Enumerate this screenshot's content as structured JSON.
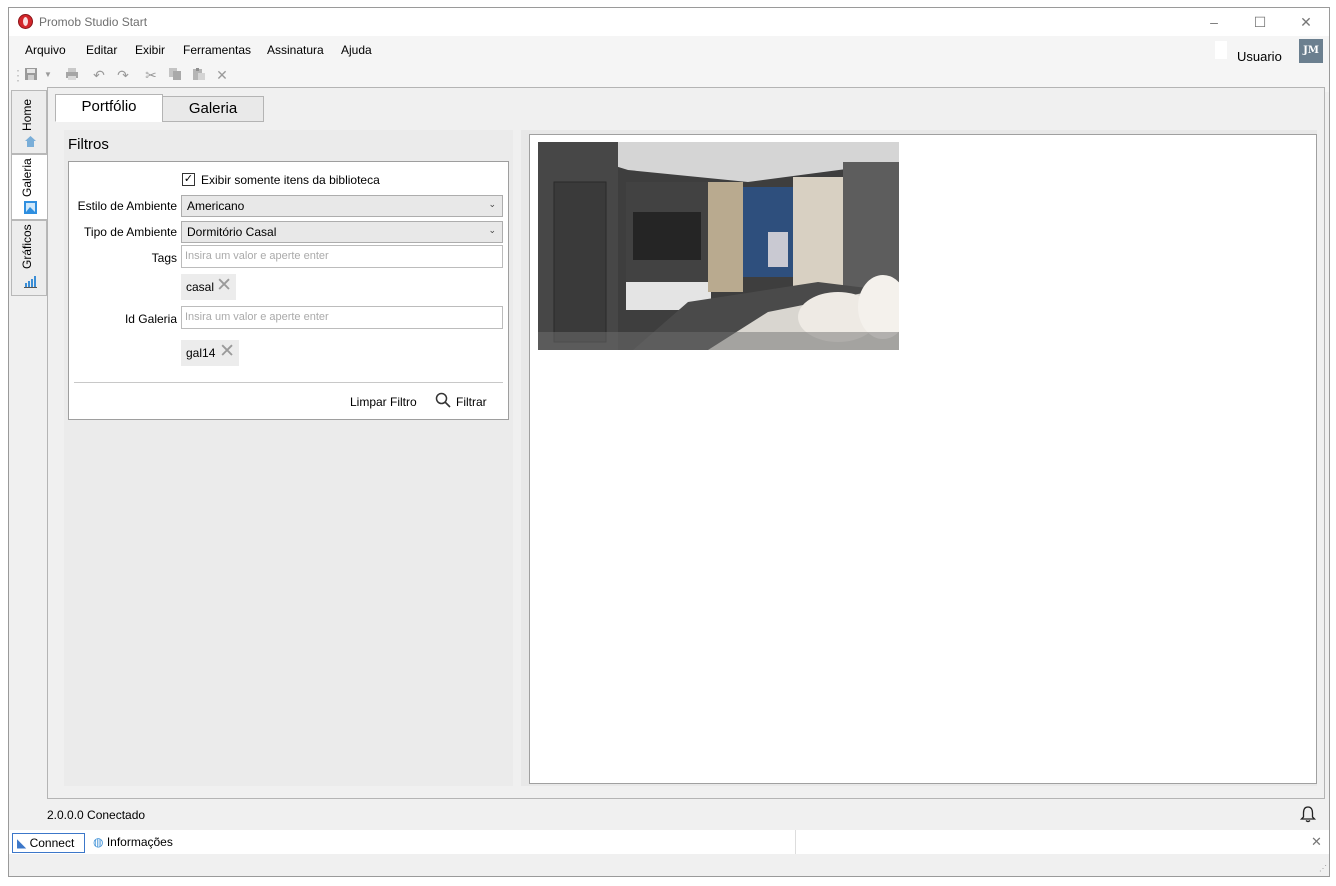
{
  "window": {
    "title": "Promob Studio Start"
  },
  "menu": [
    "Arquivo",
    "Editar",
    "Exibir",
    "Ferramentas",
    "Assinatura",
    "Ajuda"
  ],
  "user": {
    "label": "Usuario",
    "initials": "JM"
  },
  "sidebar": {
    "tabs": [
      "Home",
      "Galeria",
      "Gráficos"
    ]
  },
  "tabs": [
    "Portfólio",
    "Galeria"
  ],
  "filters": {
    "title": "Filtros",
    "checkbox_label": "Exibir somente itens da biblioteca",
    "checkbox_checked": "✓",
    "estilo_label": "Estilo de Ambiente",
    "estilo_value": "Americano",
    "tipo_label": "Tipo de Ambiente",
    "tipo_value": "Dormitório Casal",
    "tags_label": "Tags",
    "tags_placeholder": "Insira um valor e aperte enter",
    "tag_chip": "casal",
    "id_label": "Id Galeria",
    "id_placeholder": "Insira um valor e aperte enter",
    "id_chip": "gal14",
    "clear_button": "Limpar Filtro",
    "filter_button": "Filtrar"
  },
  "status": {
    "text": "2.0.0.0  Conectado"
  },
  "bottom_tabs": [
    "Connect",
    "Informações"
  ],
  "colors": {
    "accent": "#3c77c9",
    "logo": "#d3262b"
  }
}
